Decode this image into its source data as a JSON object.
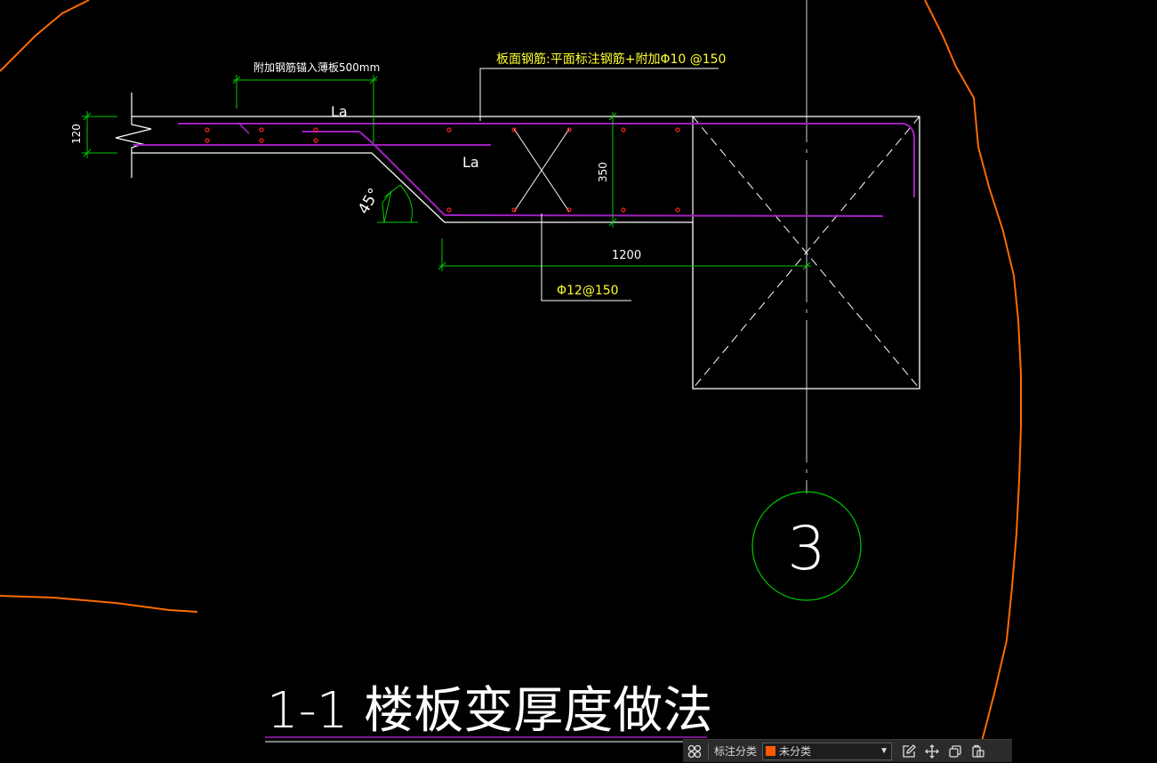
{
  "drawing": {
    "annotation_anchor": "附加钢筋锚入薄板500mm",
    "la_label_top": "La",
    "la_label_bottom": "La",
    "thickness_dim": "120",
    "depth_dim": "350",
    "angle_label": "45°",
    "span_dim": "1200",
    "top_rebar_note": "板面钢筋:平面标注钢筋+附加Φ10 @150",
    "bottom_rebar_note": "Φ12@150",
    "axis_bubble": "3",
    "title": "1-1  楼板变厚度做法"
  },
  "colors": {
    "background": "#000000",
    "outline": "#ffffff",
    "dimension": "#00cc00",
    "rebar": "#a020c0",
    "rebar_dot": "#ff2020",
    "text_yellow": "#ffff33",
    "cloud": "#ff6a00",
    "axis_bubble": "#00cc00",
    "category_swatch": "#ff5a00"
  },
  "toolbar": {
    "grid_icon": "grid-icon",
    "label": "标注分类",
    "category_value": "未分类",
    "dropdown_icon": "chevron-down-icon",
    "edit_icon": "edit-icon",
    "move_icon": "move-icon",
    "copy_icon": "copy-icon",
    "paste_icon": "paste-icon"
  }
}
